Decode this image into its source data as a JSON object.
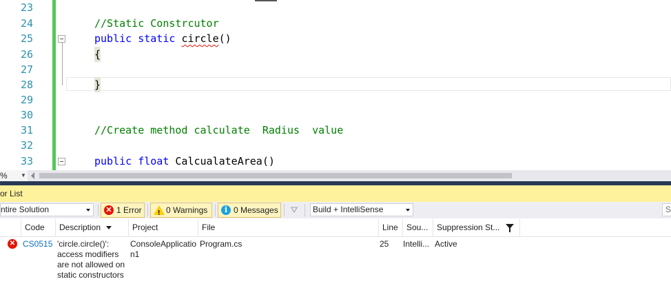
{
  "editor": {
    "lines": [
      {
        "num": "23",
        "text": ""
      },
      {
        "num": "24",
        "text": "//Static Constrcutor"
      },
      {
        "num": "25",
        "kw1": "public",
        "kw2": "static",
        "name": "circle",
        "rest": "()"
      },
      {
        "num": "26",
        "text": "{"
      },
      {
        "num": "27",
        "text": ""
      },
      {
        "num": "28",
        "text": "}"
      },
      {
        "num": "29",
        "text": ""
      },
      {
        "num": "30",
        "text": ""
      },
      {
        "num": "31",
        "text": "//Create method calculate  Radius  value"
      },
      {
        "num": "32",
        "text": ""
      },
      {
        "num": "33",
        "kw1": "public",
        "kw2": "float",
        "name": "CalcualateArea",
        "rest": "()"
      }
    ],
    "zoom_text": "%",
    "colors": {
      "keyword": "#0000ff",
      "comment": "#008000",
      "line_number": "#2b91af",
      "change_bar": "#57c757"
    }
  },
  "error_list": {
    "title": "or List",
    "scope_value": "ntire Solution",
    "errors_button": "1 Error",
    "warnings_button": "0 Warnings",
    "messages_button": "0 Messages",
    "build_filter_value": "Build + IntelliSense",
    "search_placeholder": "S",
    "columns": {
      "code": "Code",
      "description": "Description",
      "project": "Project",
      "file": "File",
      "line": "Line",
      "source": "Sou...",
      "suppression": "Suppression St..."
    },
    "rows": [
      {
        "icon": "error-icon",
        "code": "CS0515",
        "description_lines": [
          "'circle.circle()':",
          "access modifiers",
          "are not allowed on",
          "static constructors"
        ],
        "project_lines": [
          "ConsoleApplicatio",
          "n1"
        ],
        "file": "Program.cs",
        "line": "25",
        "source": "Intelli...",
        "suppression": "Active"
      }
    ],
    "colors": {
      "title_bar": "#fff29d",
      "error": "#e51400",
      "divider": "#293955"
    }
  }
}
